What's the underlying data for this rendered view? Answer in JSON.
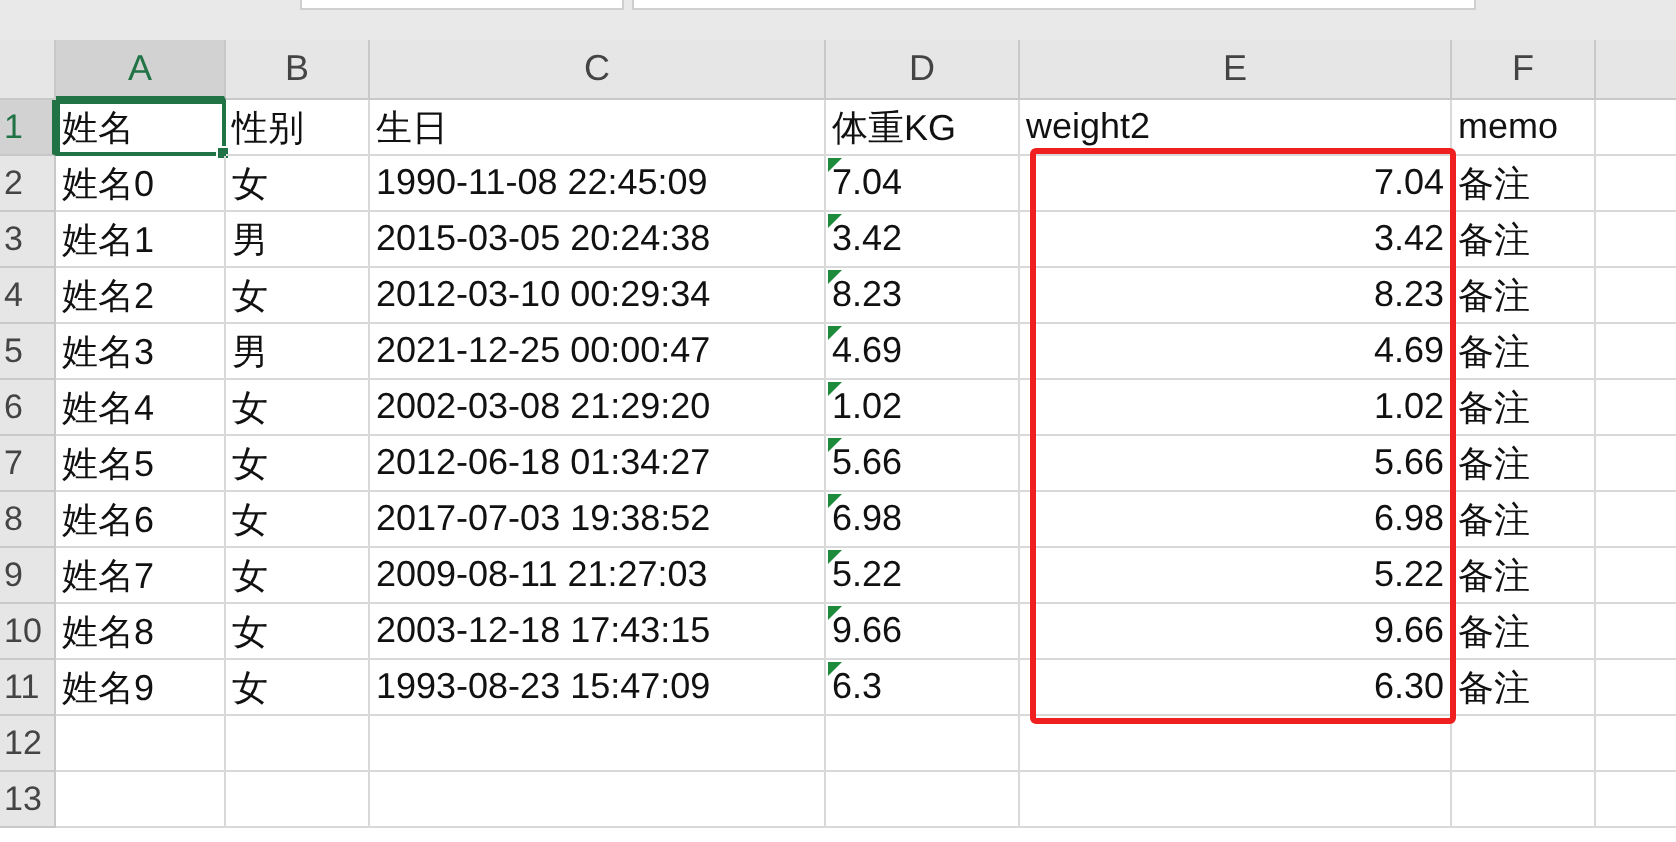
{
  "columns": [
    {
      "label": "A",
      "selected": true,
      "highlighted": false
    },
    {
      "label": "B",
      "selected": false,
      "highlighted": false
    },
    {
      "label": "C",
      "selected": false,
      "highlighted": false
    },
    {
      "label": "D",
      "selected": false,
      "highlighted": false
    },
    {
      "label": "E",
      "selected": false,
      "highlighted": true
    },
    {
      "label": "F",
      "selected": false,
      "highlighted": false
    }
  ],
  "rows": [
    {
      "label": "1",
      "selected": true,
      "cells": [
        {
          "text": "姓名",
          "selected": true
        },
        {
          "text": "性别"
        },
        {
          "text": "生日"
        },
        {
          "text": "体重KG"
        },
        {
          "text": "weight2"
        },
        {
          "text": "memo"
        }
      ]
    },
    {
      "label": "2",
      "selected": false,
      "cells": [
        {
          "text": "姓名0"
        },
        {
          "text": "女"
        },
        {
          "text": "1990-11-08 22:45:09"
        },
        {
          "text": "7.04",
          "number_as_text": true
        },
        {
          "text": "7.04",
          "numeric": true
        },
        {
          "text": "备注"
        }
      ]
    },
    {
      "label": "3",
      "selected": false,
      "cells": [
        {
          "text": "姓名1"
        },
        {
          "text": "男"
        },
        {
          "text": "2015-03-05 20:24:38"
        },
        {
          "text": "3.42",
          "number_as_text": true
        },
        {
          "text": "3.42",
          "numeric": true
        },
        {
          "text": "备注"
        }
      ]
    },
    {
      "label": "4",
      "selected": false,
      "cells": [
        {
          "text": "姓名2"
        },
        {
          "text": "女"
        },
        {
          "text": "2012-03-10 00:29:34"
        },
        {
          "text": "8.23",
          "number_as_text": true
        },
        {
          "text": "8.23",
          "numeric": true
        },
        {
          "text": "备注"
        }
      ]
    },
    {
      "label": "5",
      "selected": false,
      "cells": [
        {
          "text": "姓名3"
        },
        {
          "text": "男"
        },
        {
          "text": "2021-12-25 00:00:47"
        },
        {
          "text": "4.69",
          "number_as_text": true
        },
        {
          "text": "4.69",
          "numeric": true
        },
        {
          "text": "备注"
        }
      ]
    },
    {
      "label": "6",
      "selected": false,
      "cells": [
        {
          "text": "姓名4"
        },
        {
          "text": "女"
        },
        {
          "text": "2002-03-08 21:29:20"
        },
        {
          "text": "1.02",
          "number_as_text": true
        },
        {
          "text": "1.02",
          "numeric": true
        },
        {
          "text": "备注"
        }
      ]
    },
    {
      "label": "7",
      "selected": false,
      "cells": [
        {
          "text": "姓名5"
        },
        {
          "text": "女"
        },
        {
          "text": "2012-06-18 01:34:27"
        },
        {
          "text": "5.66",
          "number_as_text": true
        },
        {
          "text": "5.66",
          "numeric": true
        },
        {
          "text": "备注"
        }
      ]
    },
    {
      "label": "8",
      "selected": false,
      "cells": [
        {
          "text": "姓名6"
        },
        {
          "text": "女"
        },
        {
          "text": "2017-07-03 19:38:52"
        },
        {
          "text": "6.98",
          "number_as_text": true
        },
        {
          "text": "6.98",
          "numeric": true
        },
        {
          "text": "备注"
        }
      ]
    },
    {
      "label": "9",
      "selected": false,
      "cells": [
        {
          "text": "姓名7"
        },
        {
          "text": "女"
        },
        {
          "text": "2009-08-11 21:27:03"
        },
        {
          "text": "5.22",
          "number_as_text": true
        },
        {
          "text": "5.22",
          "numeric": true
        },
        {
          "text": "备注"
        }
      ]
    },
    {
      "label": "10",
      "selected": false,
      "cells": [
        {
          "text": "姓名8"
        },
        {
          "text": "女"
        },
        {
          "text": "2003-12-18 17:43:15"
        },
        {
          "text": "9.66",
          "number_as_text": true
        },
        {
          "text": "9.66",
          "numeric": true
        },
        {
          "text": "备注"
        }
      ]
    },
    {
      "label": "11",
      "selected": false,
      "cells": [
        {
          "text": "姓名9"
        },
        {
          "text": "女"
        },
        {
          "text": "1993-08-23 15:47:09"
        },
        {
          "text": "6.3",
          "number_as_text": true
        },
        {
          "text": "6.30",
          "numeric": true
        },
        {
          "text": "备注"
        }
      ]
    },
    {
      "label": "12",
      "selected": false,
      "cells": [
        {},
        {},
        {},
        {},
        {},
        {}
      ]
    },
    {
      "label": "13",
      "selected": false,
      "cells": [
        {},
        {},
        {},
        {},
        {},
        {}
      ]
    }
  ]
}
